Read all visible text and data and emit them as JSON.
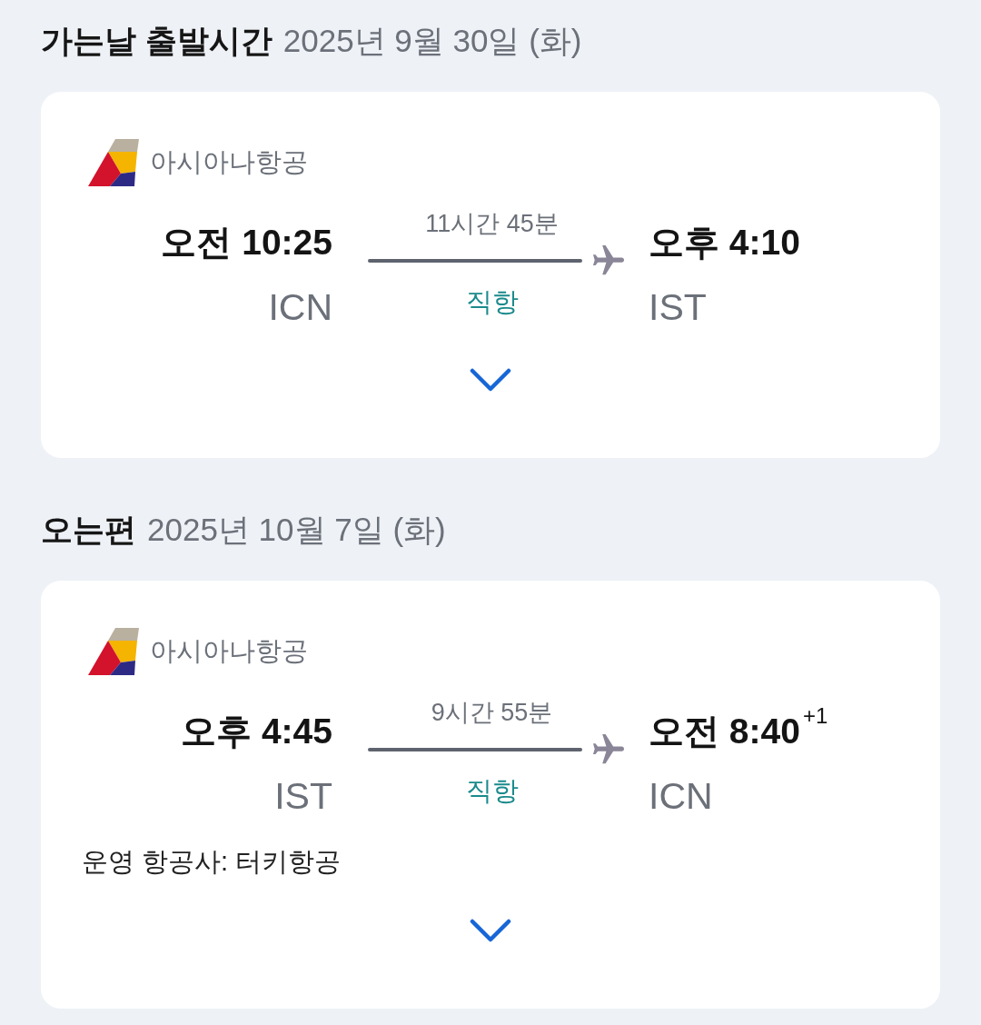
{
  "sections": [
    {
      "title": "가는날 출발시간",
      "date": "2025년 9월 30일 (화)",
      "flight": {
        "airline": "아시아나항공",
        "departure": {
          "time": "오전 10:25",
          "airport": "ICN"
        },
        "duration": "11시간 45분",
        "route_type": "직항",
        "arrival": {
          "time": "오후 4:10",
          "airport": "IST"
        },
        "expanded": false
      }
    },
    {
      "title": "오는편",
      "date": "2025년 10월 7일 (화)",
      "flight": {
        "airline": "아시아나항공",
        "departure": {
          "time": "오후 4:45",
          "airport": "IST"
        },
        "duration": "9시간 55분",
        "route_type": "직항",
        "arrival": {
          "time": "오전 8:40",
          "day_offset": "+1",
          "airport": "ICN"
        },
        "operated_by": "운영 항공사: 터키항공",
        "expanded": false
      }
    }
  ]
}
